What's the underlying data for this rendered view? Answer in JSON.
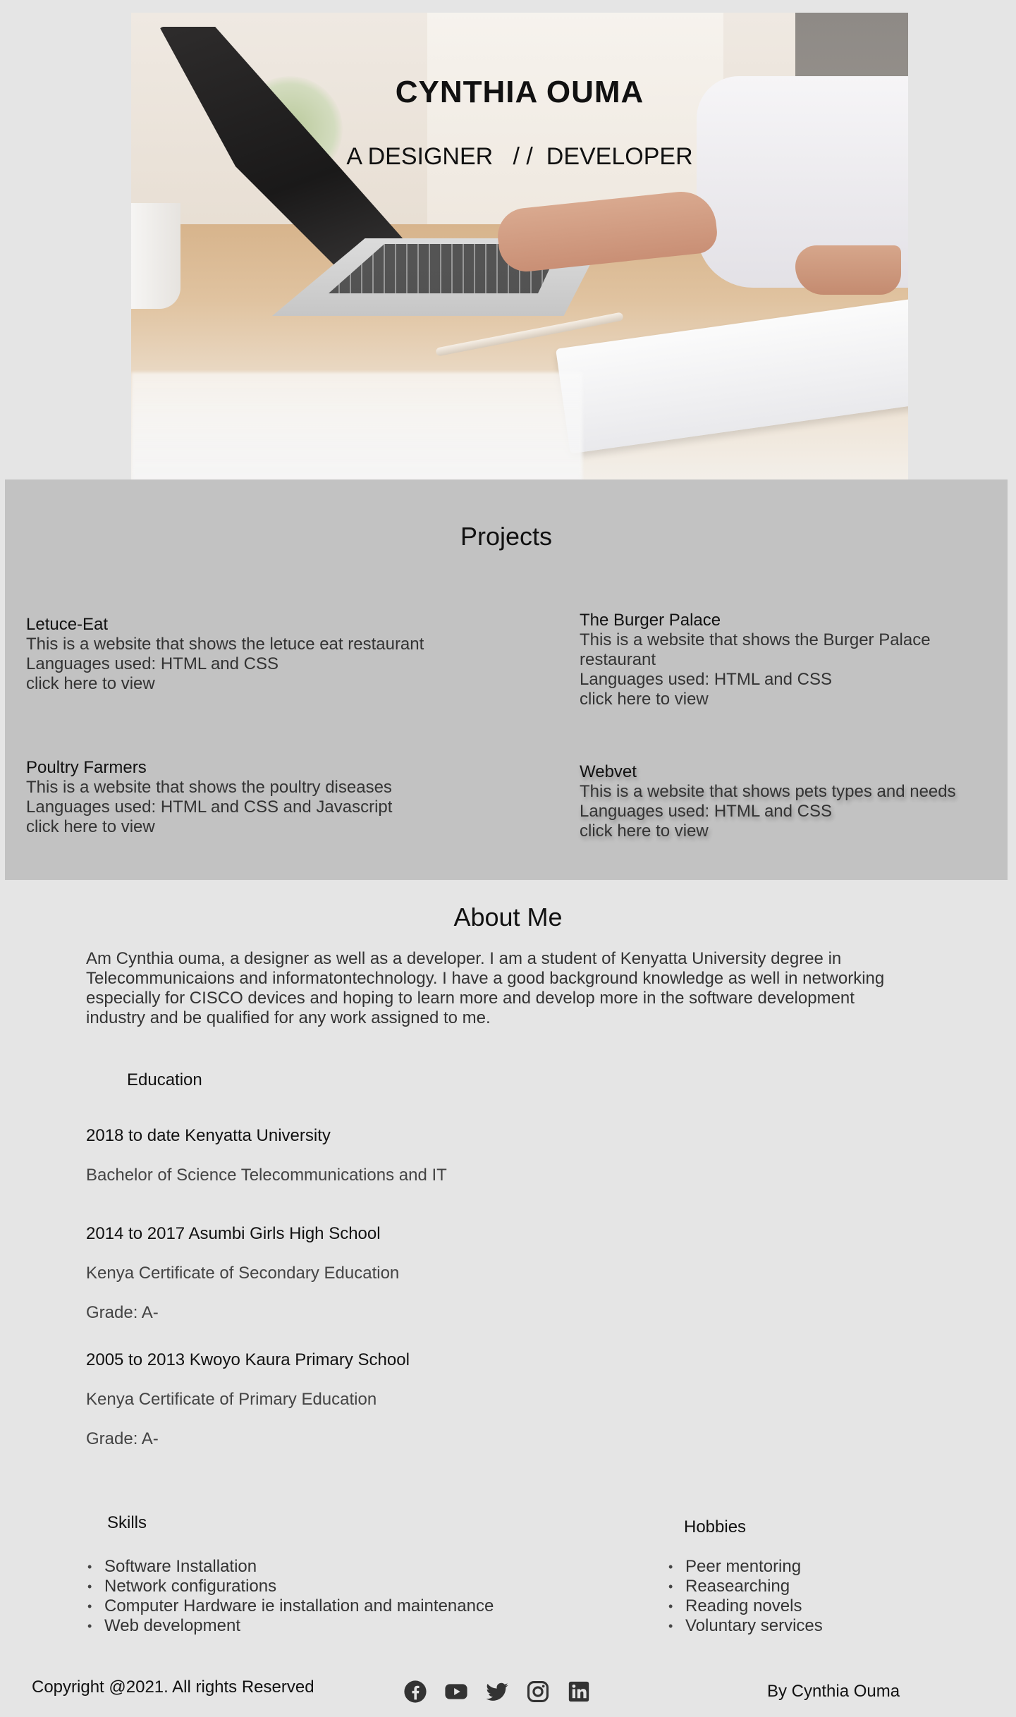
{
  "hero": {
    "title": "CYNTHIA  OUMA",
    "subtitle": "A DESIGNER   / /  DEVELOPER"
  },
  "projects": {
    "heading": "Projects",
    "items": [
      {
        "title": "Letuce-Eat",
        "description": "This is a website that shows the letuce eat restaurant",
        "languages": "Languages used: HTML and CSS",
        "link": "click here to view"
      },
      {
        "title": "The Burger Palace",
        "description": "This is a website that shows the Burger Palace restaurant",
        "languages": "Languages used: HTML and CSS",
        "link": "click here to view"
      },
      {
        "title": "Poultry Farmers",
        "description": "This is a website that shows the poultry diseases",
        "languages": "Languages used: HTML and CSS  and Javascript",
        "link": "click here to view"
      },
      {
        "title": "Webvet",
        "description": "This is a website that shows  pets types and needs",
        "languages": "Languages used: HTML and CSS",
        "link": "click here to view"
      }
    ]
  },
  "about": {
    "heading": "About Me",
    "text": "Am Cynthia ouma, a designer as well as a developer. I am a student of Kenyatta University degree in Telecommunicaions and informatontechnology.  I have  a good background knowledge as well in networking especially for CISCO devices and hoping to learn more and develop more in the software development industry and be qualified for any work assigned to me."
  },
  "education": {
    "heading": "Education",
    "items": [
      {
        "head": "2018 to date  Kenyatta University",
        "lines": [
          "Bachelor of Science Telecommunications and IT"
        ]
      },
      {
        "head": "2014 to 2017 Asumbi Girls High School",
        "lines": [
          "Kenya Certificate of Secondary Education",
          "Grade: A-"
        ]
      },
      {
        "head": "2005 to 2013 Kwoyo Kaura Primary School",
        "lines": [
          "Kenya Certificate of Primary Education",
          "Grade: A-"
        ]
      }
    ]
  },
  "skills": {
    "heading": "Skills",
    "items": [
      "Software Installation",
      "Network configurations",
      "Computer Hardware ie installation and maintenance",
      "Web development"
    ]
  },
  "hobbies": {
    "heading": "Hobbies",
    "items": [
      "Peer mentoring",
      "Reasearching",
      "Reading novels",
      "Voluntary services"
    ]
  },
  "footer": {
    "copyright": "Copyright @2021. All rights Reserved",
    "byline": "By Cynthia Ouma",
    "social_icons": [
      "facebook-icon",
      "youtube-icon",
      "twitter-icon",
      "instagram-icon",
      "linkedin-icon"
    ],
    "icon_color": "#333333"
  }
}
